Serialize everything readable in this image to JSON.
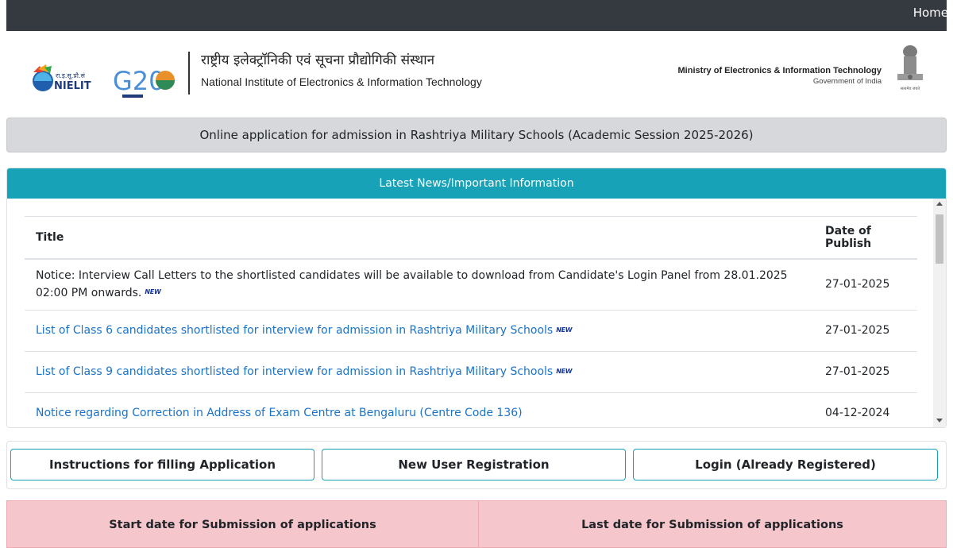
{
  "nav": {
    "home": "Home"
  },
  "header": {
    "logo_hindi_text": "रा.इ.सू.प्रौ.सं",
    "logo_text": "NIELIT",
    "g20_text": "G20",
    "hindi_name": "राष्ट्रीय इलेक्ट्रॉनिकी एवं सूचना प्रौद्योगिकी संस्थान",
    "english_name": "National Institute of Electronics & Information Technology",
    "ministry_name": "Ministry of Electronics & Information Technology",
    "ministry_sub": "Government of India",
    "emblem_caption": "सत्यमेव जयते"
  },
  "app_title": "Online application for admission in Rashtriya Military Schools (Academic Session 2025-2026)",
  "news": {
    "heading": "Latest News/Important Information",
    "col_title": "Title",
    "col_date": "Date of Publish",
    "new_label": "NEW",
    "rows": [
      {
        "title": "Notice: Interview Call Letters to the shortlisted candidates will be available to download from Candidate's Login Panel from 28.01.2025 02:00 PM onwards.",
        "date": "27-01-2025",
        "is_link": false
      },
      {
        "title": "List of Class 6 candidates shortlisted for interview for admission in Rashtriya Military Schools",
        "date": "27-01-2025",
        "is_link": true
      },
      {
        "title": "List of Class 9 candidates shortlisted for interview for admission in Rashtriya Military Schools",
        "date": "27-01-2025",
        "is_link": true
      },
      {
        "title": "Notice regarding Correction in Address of Exam Centre at Bengaluru (Centre Code 136)",
        "date": "04-12-2024",
        "is_link": true
      }
    ]
  },
  "buttons": {
    "instructions": "Instructions for filling Application",
    "register": "New User Registration",
    "login": "Login (Already Registered)"
  },
  "dates": {
    "start_label": "Start date for Submission of applications",
    "last_label": "Last date for Submission of applications"
  }
}
